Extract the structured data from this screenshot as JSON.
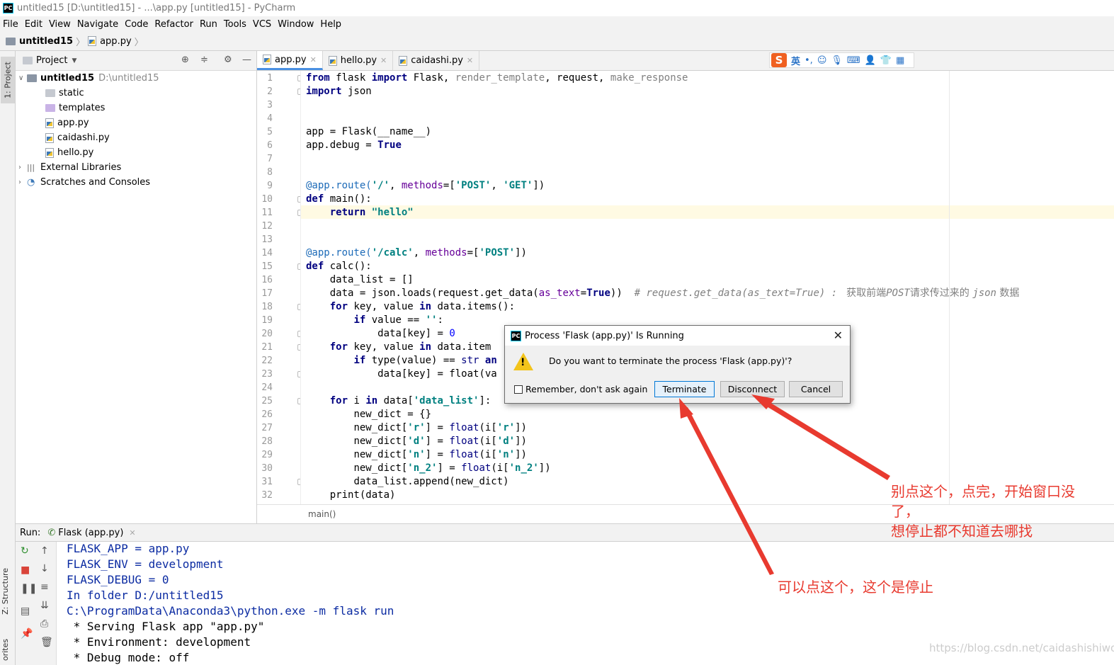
{
  "window": {
    "title": "untitled15 [D:\\untitled15] - ...\\app.py [untitled15] - PyCharm",
    "app_icon": "PC"
  },
  "menu": [
    "File",
    "Edit",
    "View",
    "Navigate",
    "Code",
    "Refactor",
    "Run",
    "Tools",
    "VCS",
    "Window",
    "Help"
  ],
  "nav": {
    "project": "untitled15",
    "file": "app.py"
  },
  "side_tabs": {
    "project": "1: Project",
    "structure": "Z: Structure",
    "favorites": "orites"
  },
  "project_panel": {
    "header": "Project",
    "root_name": "untitled15",
    "root_path": "D:\\untitled15",
    "items": [
      "static",
      "templates",
      "app.py",
      "caidashi.py",
      "hello.py"
    ],
    "external": "External Libraries",
    "scratches": "Scratches and Consoles"
  },
  "tabs": [
    "app.py",
    "hello.py",
    "caidashi.py"
  ],
  "ime": {
    "s": "S",
    "lang": "英",
    "punct": "•,"
  },
  "editor": {
    "line_numbers": [
      "1",
      "2",
      "3",
      "4",
      "5",
      "6",
      "7",
      "8",
      "9",
      "10",
      "11",
      "12",
      "13",
      "14",
      "15",
      "16",
      "17",
      "18",
      "19",
      "20",
      "21",
      "22",
      "23",
      "24",
      "25",
      "26",
      "27",
      "28",
      "29",
      "30",
      "31",
      "32"
    ],
    "breadcrumb": "main()",
    "l1": {
      "from": "from",
      "mod": " flask ",
      "import": "import",
      "names": " Flask, ",
      "unused": "render_template",
      "c": ", request, ",
      "unused2": "make_response"
    },
    "l2": {
      "import": "import",
      "rest": " json"
    },
    "l5": "app = Flask(__name__)",
    "l6": {
      "a": "app.debug = ",
      "true": "True"
    },
    "l9": {
      "dec": "@app.route(",
      "s1": "'/'",
      "c": ", ",
      "param": "methods",
      "eq": "=[",
      "s2": "'POST'",
      "c2": ", ",
      "s3": "'GET'",
      "end": "])"
    },
    "l10": {
      "def": "def",
      "rest": " main():"
    },
    "l11": {
      "ret": "return",
      "s": "\"hello\""
    },
    "l14": {
      "dec": "@app.route(",
      "s1": "'/calc'",
      "c": ", ",
      "param": "methods",
      "eq": "=[",
      "s2": "'POST'",
      "end": "])"
    },
    "l15": {
      "def": "def",
      "rest": " calc():"
    },
    "l16": "data_list = []",
    "l17": {
      "a": "data = json.loads(request.get_data(",
      "param": "as_text",
      "eq": "=",
      "true": "True",
      "b": "))  ",
      "cm": "# request.get_data(as_text=True) : ",
      "cn": " 获取前端",
      "cm2": "POST",
      "cn2": "请求传过来的 ",
      "cm3": "json",
      "cn3": " 数据"
    },
    "l18": {
      "for": "for",
      "a": " key, value ",
      "in": "in",
      "b": " data.items():"
    },
    "l19": {
      "if": "if",
      "a": " value == ",
      "s": "''",
      "b": ":"
    },
    "l20": {
      "a": "data[key] = ",
      "n": "0"
    },
    "l21": {
      "for": "for",
      "a": " key, value ",
      "in": "in",
      "b": " data.item"
    },
    "l22": {
      "if": "if",
      "a": " type(value) == ",
      "str": "str",
      "b": " ",
      "and": "an"
    },
    "l23": {
      "a": "data[key] = float(va"
    },
    "l25": {
      "for": "for",
      "a": " i ",
      "in": "in",
      "b": " data[",
      "s": "'data_list'",
      "c": "]:"
    },
    "l26": "new_dict = {}",
    "l27": {
      "a": "new_dict[",
      "s": "'r'",
      "b": "] = ",
      "f": "float",
      "c": "(i[",
      "s2": "'r'",
      "d": "])"
    },
    "l28": {
      "a": "new_dict[",
      "s": "'d'",
      "b": "] = ",
      "f": "float",
      "c": "(i[",
      "s2": "'d'",
      "d": "])"
    },
    "l29": {
      "a": "new_dict[",
      "s": "'n'",
      "b": "] = ",
      "f": "float",
      "c": "(i[",
      "s2": "'n'",
      "d": "])"
    },
    "l30": {
      "a": "new_dict[",
      "s": "'n_2'",
      "b": "] = ",
      "f": "float",
      "c": "(i[",
      "s2": "'n_2'",
      "d": "])"
    },
    "l31": "data_list.append(new_dict)",
    "l32": "print(data)"
  },
  "run": {
    "label": "Run:",
    "tab": "Flask (app.py)",
    "console": [
      "FLASK_APP = app.py",
      "FLASK_ENV = development",
      "FLASK_DEBUG = 0",
      "In folder D:/untitled15",
      "C:\\ProgramData\\Anaconda3\\python.exe -m flask run",
      " * Serving Flask app \"app.py\"",
      " * Environment: development",
      " * Debug mode: off"
    ]
  },
  "dialog": {
    "title": "Process 'Flask (app.py)' Is Running",
    "message": "Do you want to terminate the process 'Flask (app.py)'?",
    "remember": "Remember, don't ask again",
    "terminate": "Terminate",
    "disconnect": "Disconnect",
    "cancel": "Cancel",
    "close": "✕"
  },
  "annotations": {
    "a1_line1": "别点这个，点完，开始窗口没",
    "a1_line2": "了，",
    "a1_line3": "想停止都不知道去哪找",
    "a2": "可以点这个，这个是停止",
    "color": "#e83a2f"
  },
  "watermark": "https://blog.csdn.net/caidashishiwo"
}
